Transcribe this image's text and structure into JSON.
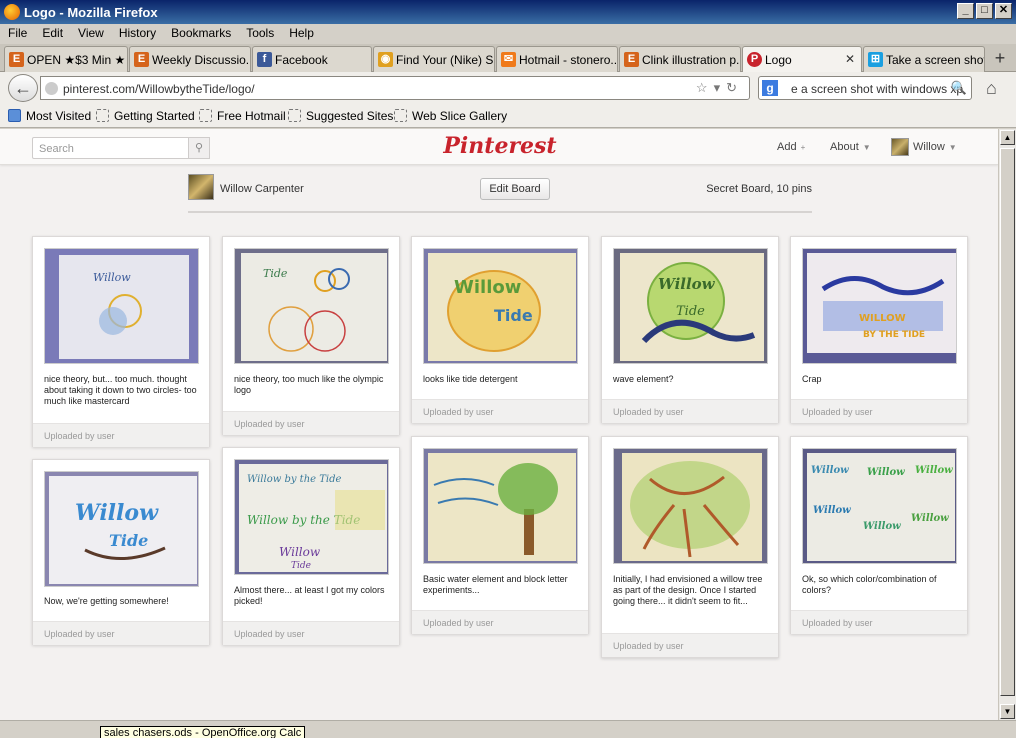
{
  "window": {
    "title": "Logo - Mozilla Firefox",
    "buttons": {
      "min": "_",
      "max": "□",
      "close": "✕"
    }
  },
  "menu": [
    "File",
    "Edit",
    "View",
    "History",
    "Bookmarks",
    "Tools",
    "Help"
  ],
  "tabs": [
    {
      "label": "OPEN ★$3 Min ★ ...",
      "icon": "etsy-icon",
      "icon_color": "#d5641c",
      "glyph": "E"
    },
    {
      "label": "Weekly Discussio...",
      "icon": "etsy-icon",
      "icon_color": "#d5641c",
      "glyph": "E"
    },
    {
      "label": "Facebook",
      "icon": "facebook-icon",
      "icon_color": "#3b5998",
      "glyph": "f"
    },
    {
      "label": "Find Your (Nike) S...",
      "icon": "chrome-icon",
      "icon_color": "#e0a020",
      "glyph": "◉"
    },
    {
      "label": "Hotmail - stonero...",
      "icon": "hotmail-icon",
      "icon_color": "#f07a1a",
      "glyph": "✉"
    },
    {
      "label": "Clink illustration p...",
      "icon": "etsy-icon",
      "icon_color": "#d5641c",
      "glyph": "E"
    },
    {
      "label": "Logo",
      "icon": "pinterest-icon",
      "icon_color": "#c8232c",
      "glyph": "P",
      "active": true
    },
    {
      "label": "Take a screen shot",
      "icon": "windows-icon",
      "icon_color": "#1a9fe0",
      "glyph": "⊞"
    }
  ],
  "url": "pinterest.com/WillowbytheTide/logo/",
  "search_text": "e a screen shot with windows xp",
  "bookmarks": [
    "Most Visited",
    "Getting Started",
    "Free Hotmail",
    "Suggested Sites",
    "Web Slice Gallery"
  ],
  "pinterest": {
    "search_placeholder": "Search",
    "logo": "Pinterest",
    "nav": {
      "add": "Add",
      "about": "About",
      "user": "Willow"
    },
    "board": {
      "owner": "Willow Carpenter",
      "edit": "Edit Board",
      "info": "Secret Board, 10 pins"
    },
    "uploaded": "Uploaded by user",
    "pins": [
      {
        "caption": "nice theory, but... too much. thought about taking it down to two circles- too much like mastercard"
      },
      {
        "caption": "nice theory, too much like the olympic logo"
      },
      {
        "caption": "looks like tide detergent"
      },
      {
        "caption": "wave element?"
      },
      {
        "caption": "Crap"
      },
      {
        "caption": "Now, we're getting somewhere!"
      },
      {
        "caption": "Almost there... at least I got my colors picked!"
      },
      {
        "caption": "Basic water element and block letter experiments..."
      },
      {
        "caption": "Initially, I had envisioned a willow tree as part of the design. Once I started going there... it didn't seem to fit..."
      },
      {
        "caption": "Ok, so which color/combination of colors?"
      }
    ]
  },
  "tooltip": "sales chasers.ods - OpenOffice.org Calc"
}
